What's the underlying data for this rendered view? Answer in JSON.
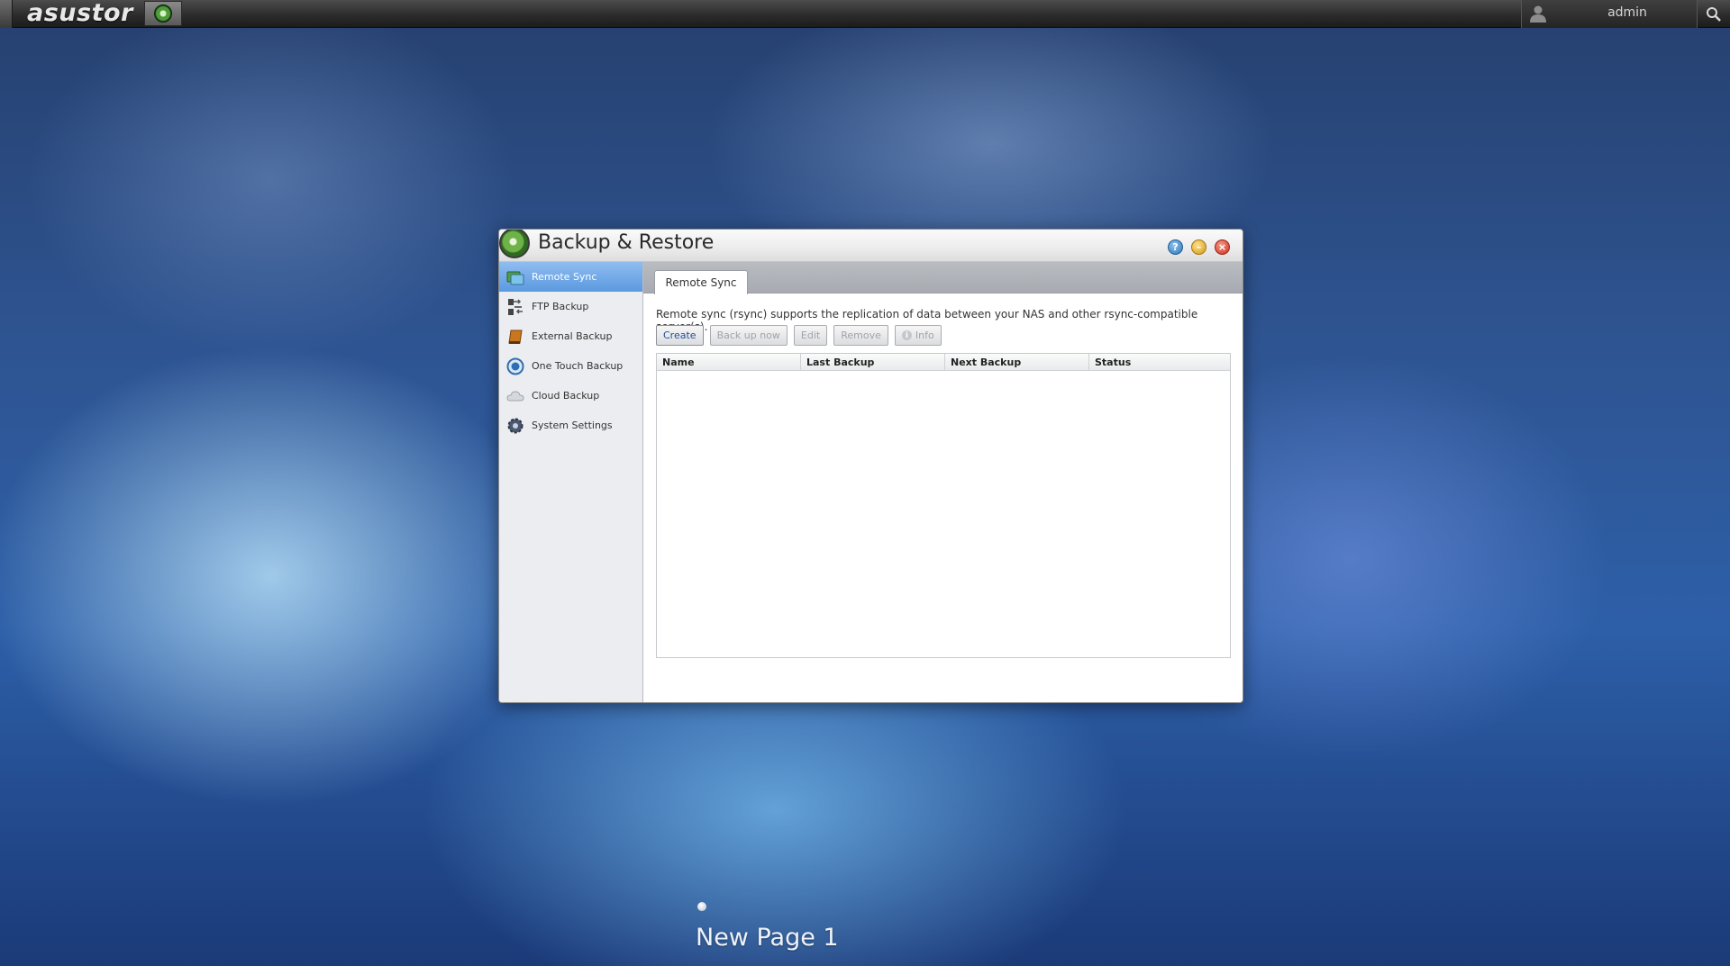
{
  "taskbar": {
    "logo": "asustor",
    "app_icon": "backup-restore-icon",
    "user": {
      "name": "admin",
      "icon": "user-icon"
    },
    "search_icon": "search-icon"
  },
  "window": {
    "title": "Backup & Restore",
    "controls": [
      "help-icon",
      "minimize-icon",
      "close-icon"
    ],
    "sidebar": {
      "items": [
        {
          "label": "Remote Sync",
          "icon": "remote-sync-icon",
          "active": true
        },
        {
          "label": "FTP Backup",
          "icon": "ftp-backup-icon"
        },
        {
          "label": "External Backup",
          "icon": "external-backup-icon"
        },
        {
          "label": "One Touch Backup",
          "icon": "one-touch-backup-icon"
        },
        {
          "label": "Cloud Backup",
          "icon": "cloud-backup-icon"
        },
        {
          "label": "System Settings",
          "icon": "system-settings-icon"
        }
      ]
    },
    "content": {
      "tab": "Remote Sync",
      "description": "Remote sync (rsync) supports the replication of data between your NAS and other rsync-compatible server(s).",
      "buttons": {
        "create": "Create",
        "backup_now": "Back up now",
        "edit": "Edit",
        "remove": "Remove",
        "info": "Info"
      },
      "table": {
        "columns": [
          "Name",
          "Last Backup",
          "Next Backup",
          "Status"
        ],
        "rows": []
      }
    }
  },
  "desktop": {
    "page_label": "New Page 1"
  }
}
